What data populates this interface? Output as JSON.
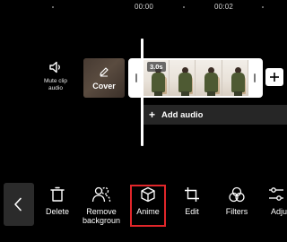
{
  "timeline": {
    "ruler": {
      "time_1": "00:00",
      "time_2": "00:02"
    },
    "mute_clip_audio": {
      "label": "Mute clip audio",
      "icon": "speaker-icon"
    },
    "cover": {
      "label": "Cover",
      "icon": "pencil-icon"
    },
    "clip": {
      "duration": "3.0s",
      "frame_count": 4
    },
    "add_audio": {
      "plus": "+",
      "label": "Add audio"
    }
  },
  "toolbar": {
    "back_icon": "chevron-left-icon",
    "delete": {
      "label": "Delete",
      "icon": "trash-icon"
    },
    "remove_background": {
      "label": "Remove backgroun",
      "icon": "person-cutout-icon"
    },
    "anime": {
      "label": "Anime",
      "icon": "cube-icon"
    },
    "edit": {
      "label": "Edit",
      "icon": "crop-icon"
    },
    "filters": {
      "label": "Filters",
      "icon": "filters-icon"
    },
    "adjust": {
      "label": "Adju",
      "icon": "adjust-icon"
    }
  },
  "colors": {
    "background": "#000000",
    "highlight": "#e0262a",
    "audio_track": "#262626",
    "back_button": "#2b2b2b"
  }
}
